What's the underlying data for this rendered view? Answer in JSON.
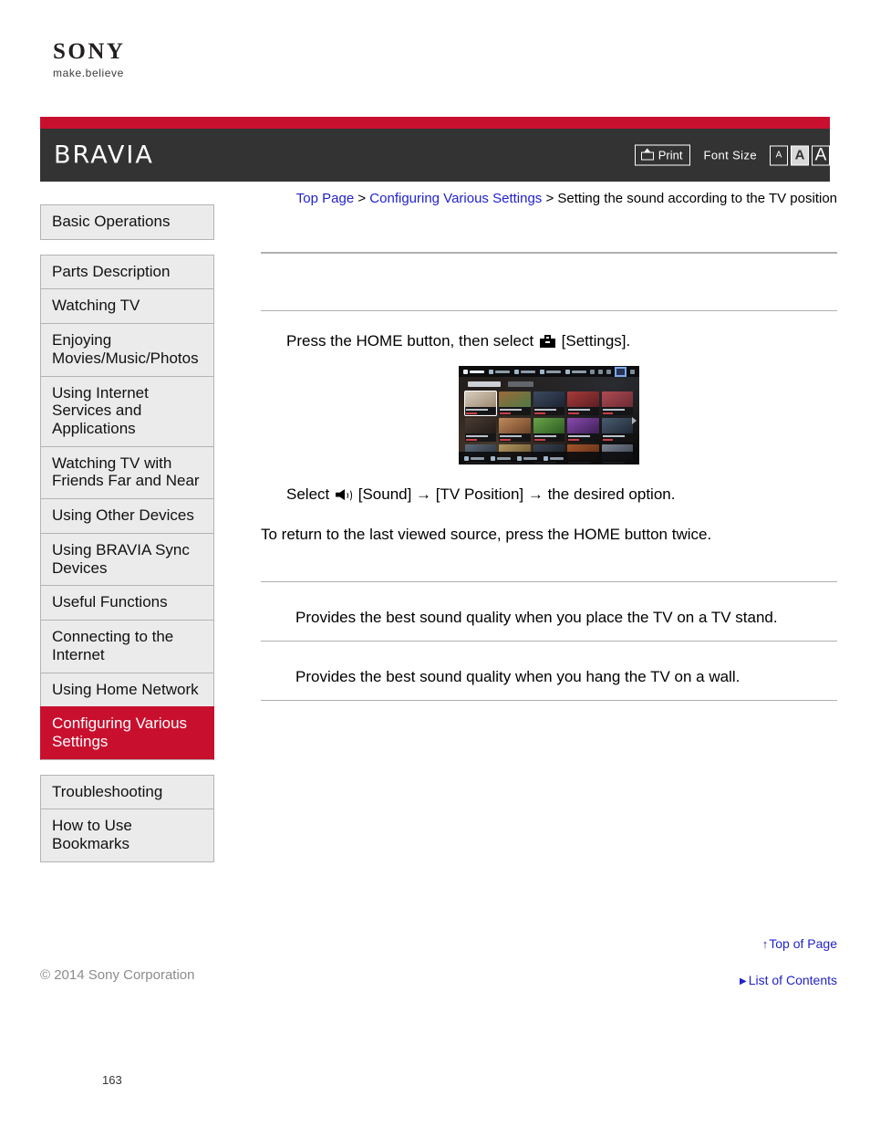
{
  "brand": {
    "wordmark": "SONY",
    "tagline": "make.believe",
    "product_logo": "BRAVIA",
    "accent_red": "#c8102e",
    "masthead_dark": "#333333",
    "link_blue": "#2222cc"
  },
  "masthead": {
    "print_label": "Print",
    "font_size_label": "Font Size",
    "font_sizes": [
      {
        "label": "A",
        "size": "small",
        "selected": false
      },
      {
        "label": "A",
        "size": "medium",
        "selected": true
      },
      {
        "label": "A",
        "size": "large",
        "selected": false
      }
    ]
  },
  "breadcrumb": {
    "items": [
      {
        "label": "Top Page",
        "link": true
      },
      {
        "label": "Configuring Various Settings",
        "link": true
      },
      {
        "label": "Setting the sound according to the TV position",
        "link": false
      }
    ],
    "separator": ">"
  },
  "sidebar": {
    "groups": [
      {
        "items": [
          {
            "label": "Basic Operations",
            "active": false
          }
        ]
      },
      {
        "items": [
          {
            "label": "Parts Description",
            "active": false
          },
          {
            "label": "Watching TV",
            "active": false
          },
          {
            "label": "Enjoying Movies/Music/Photos",
            "active": false
          },
          {
            "label": "Using Internet Services and Applications",
            "active": false
          },
          {
            "label": "Watching TV with Friends Far and Near",
            "active": false
          },
          {
            "label": "Using Other Devices",
            "active": false
          },
          {
            "label": "Using BRAVIA Sync Devices",
            "active": false
          },
          {
            "label": "Useful Functions",
            "active": false
          },
          {
            "label": "Connecting to the Internet",
            "active": false
          },
          {
            "label": "Using Home Network",
            "active": false
          },
          {
            "label": "Configuring Various Settings",
            "active": true
          }
        ]
      },
      {
        "items": [
          {
            "label": "Troubleshooting",
            "active": false
          },
          {
            "label": "How to Use Bookmarks",
            "active": false
          }
        ]
      }
    ]
  },
  "content": {
    "section_title": "",
    "steps": [
      {
        "before_icon": "Press the HOME button, then select",
        "icon": "settings-toolbox-icon",
        "after_icon": "[Settings]."
      }
    ],
    "select_line": {
      "before_icon": "Select",
      "icon": "sound-speaker-icon",
      "after_icon": "[Sound] → [TV Position] → the desired option."
    },
    "return_note": "To return to the last viewed source, press the HOME button twice.",
    "options": [
      {
        "name": "",
        "description": "Provides the best sound quality when you place the TV on a TV stand."
      },
      {
        "name": "",
        "description": "Provides the best sound quality when you hang the TV on a wall."
      }
    ]
  },
  "figure": {
    "caption": "",
    "tv_home_screen": {
      "top_menu": [
        "Channel",
        "Movies",
        "Album",
        "Music",
        "Apps"
      ],
      "tabs": [
        "TV Shows",
        "Recommend"
      ],
      "bottom_menu": [
        "Connected Devices",
        "Inputs",
        "Rec List",
        "Settings"
      ]
    }
  },
  "footer": {
    "top_of_page": "Top of Page",
    "list_of_contents": "List of Contents",
    "copyright": "© 2014 Sony Corporation",
    "page_number": "163"
  }
}
